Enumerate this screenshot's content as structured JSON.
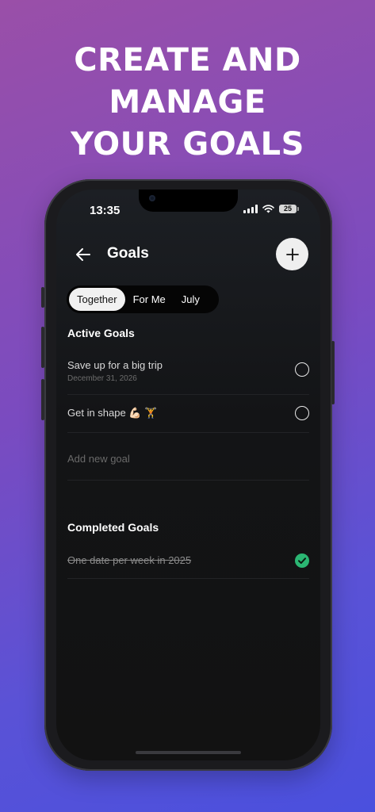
{
  "headline": {
    "line1": "CREATE AND",
    "line2": "MANAGE",
    "line3": "YOUR GOALS"
  },
  "status_bar": {
    "time": "13:35",
    "battery": "25"
  },
  "nav": {
    "title": "Goals",
    "back_icon": "arrow-left-icon",
    "add_icon": "plus-icon"
  },
  "tabs": [
    {
      "label": "Together",
      "active": true
    },
    {
      "label": "For Me",
      "active": false
    },
    {
      "label": "July",
      "active": false
    }
  ],
  "active_goals": {
    "title": "Active Goals",
    "items": [
      {
        "title": "Save up for a big trip",
        "subtitle": "December 31, 2026",
        "done": false
      },
      {
        "title": "Get in shape 💪🏻 🏋",
        "subtitle": "",
        "done": false
      }
    ],
    "add_placeholder": "Add new goal"
  },
  "completed_goals": {
    "title": "Completed Goals",
    "items": [
      {
        "title": "One date per week in 2025",
        "done": true
      }
    ]
  },
  "colors": {
    "accent_check": "#2bb673",
    "bg_gradient_start": "#9a4fa8",
    "bg_gradient_end": "#4a50de"
  }
}
